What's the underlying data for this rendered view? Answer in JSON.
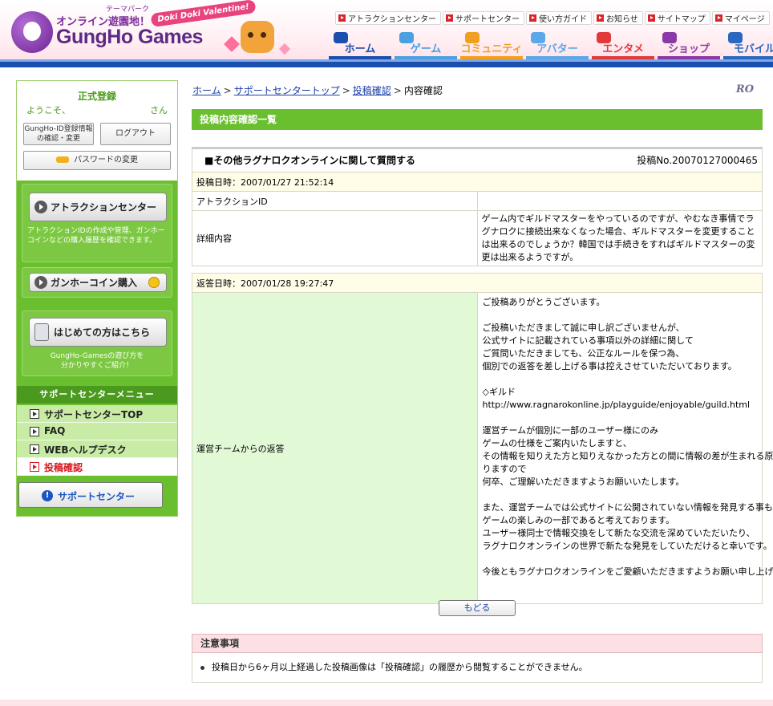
{
  "header": {
    "theme_text": "テーマパーク",
    "tagline": "オンライン遊園地！",
    "logo": "GungHo Games",
    "valentine": "Doki Doki Valentine!",
    "util_links": [
      "アトラクションセンター",
      "サポートセンター",
      "使い方ガイド",
      "お知らせ",
      "サイトマップ",
      "マイページ"
    ],
    "main_tabs": [
      {
        "label": "ホーム",
        "color": "#1a4fb0",
        "bar": "#1a4fb0"
      },
      {
        "label": "ゲーム",
        "color": "#4aa0e0",
        "bar": "#4aa0e0"
      },
      {
        "label": "コミュニティ",
        "color": "#f0a020",
        "bar": "#f0a020"
      },
      {
        "label": "アバター",
        "color": "#5aa8e8",
        "bar": "#5aa8e8"
      },
      {
        "label": "エンタメ",
        "color": "#e03a3a",
        "bar": "#e03a3a"
      },
      {
        "label": "ショップ",
        "color": "#8a3aa8",
        "bar": "#8a3aa8"
      },
      {
        "label": "モバイル",
        "color": "#2a68c0",
        "bar": "#2a68c0"
      }
    ]
  },
  "sidebar": {
    "register": "正式登録",
    "welcome": "ようこそ、",
    "san": "さん",
    "id_confirm_line1": "GungHo-ID登録情報",
    "id_confirm_line2": "の確認・変更",
    "logout": "ログアウト",
    "password": "パスワードの変更",
    "attraction_btn": "アトラクションセンター",
    "attraction_desc": "アトラクションIDの作成や管理、ガンホーコインなどの購入履歴を確認できます。",
    "coin_btn": "ガンホーコイン購入",
    "beginner_btn": "はじめての方はこちら",
    "beginner_desc_line1": "GungHo-Gamesの遊び方を",
    "beginner_desc_line2": "分かりやすくご紹介！",
    "menu_header": "サポートセンターメニュー",
    "menu": [
      "サポートセンターTOP",
      "FAQ",
      "WEBヘルプデスク",
      "投稿確認"
    ],
    "support_btn": "サポートセンター"
  },
  "breadcrumb": {
    "home": "ホーム",
    "support_top": "サポートセンタートップ",
    "post_confirm": "投稿確認",
    "current": "内容確認"
  },
  "ro_logo": "RO",
  "section_title": "投稿内容確認一覧",
  "post": {
    "title": "■その他ラグナロクオンラインに関して質問する",
    "number": "投稿No.20070127000465",
    "date": "投稿日時：2007/01/27 21:52:14",
    "attraction_label": "アトラクションID",
    "attraction_value": "",
    "detail_label": "詳細内容",
    "detail_text": "ゲーム内でギルドマスターをやっているのですが、やむなき事情でラグナロクに接続出来なくなった場合、ギルドマスターを変更することは出来るのでしょうか？韓国では手続きをすればギルドマスターの変更は出来るようですが。"
  },
  "reply": {
    "date": "返答日時：2007/01/28 19:27:47",
    "label": "運営チームからの返答",
    "lines": [
      "ご投稿ありがとうございます。",
      "",
      "ご投稿いただきまして誠に申し訳ございませんが、",
      "公式サイトに記載されている事項以外の詳細に関して",
      "ご質問いただきましても、公正なルールを保つ為、",
      "個別での返答を差し上げる事は控えさせていただいております。",
      "",
      "◇ギルド",
      "http://www.ragnarokonline.jp/playguide/enjoyable/guild.html",
      "",
      "運営チームが個別に一部のユーザー様にのみ",
      "ゲームの仕様をご案内いたしますと、",
      "その情報を知りえた方と知りえなかった方との間に情報の差が生まれる原因とな",
      "りますので",
      "何卒、ご理解いただきますようお願いいたします。",
      "",
      "また、運営チームでは公式サイトに公開されていない情報を発見する事も",
      "ゲームの楽しみの一部であると考えております。",
      "ユーザー様同士で情報交換をして新たな交流を深めていただいたり、",
      "ラグナロクオンラインの世界で新たな発見をしていただけると幸いです。",
      "",
      "今後ともラグナロクオンラインをご愛顧いただきますようお願い申し上げます。"
    ]
  },
  "back_button": "もどる",
  "notice": {
    "header": "注意事項",
    "item": "投稿日から6ヶ月以上経過した投稿画像は「投稿確認」の履歴から閲覧することができません。"
  }
}
